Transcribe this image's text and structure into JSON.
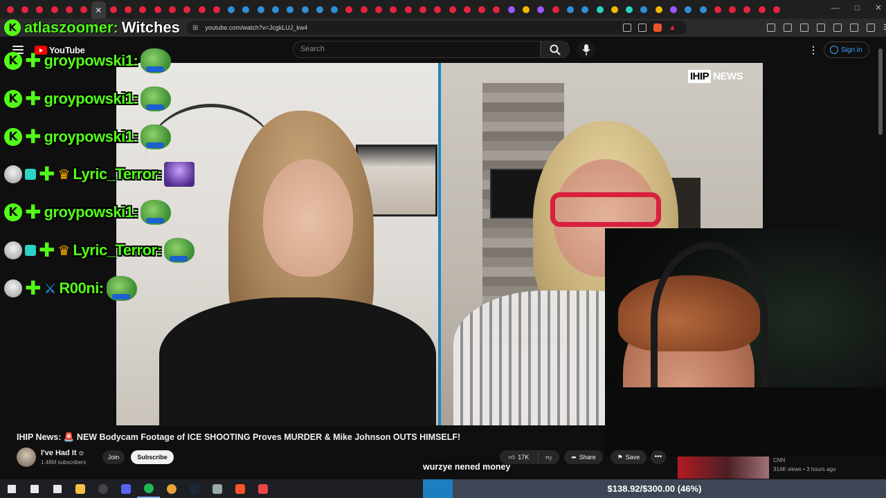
{
  "browser": {
    "url": "youtube.com/watch?v=JcgkLUJ_kw4",
    "tab_colors": [
      "#e8243d",
      "#e8243d",
      "#e8243d",
      "#e8243d",
      "#e8243d",
      "#e8243d",
      "#3a3a3a",
      "#e8243d",
      "#e8243d",
      "#e8243d",
      "#e8243d",
      "#e8243d",
      "#e8243d",
      "#e8243d",
      "#e8243d",
      "#2f8fd6",
      "#2f8fd6",
      "#2f8fd6",
      "#2f8fd6",
      "#2f8fd6",
      "#2f8fd6",
      "#2f8fd6",
      "#2f8fd6",
      "#e8243d",
      "#e8243d",
      "#e8243d",
      "#e8243d",
      "#e8243d",
      "#e8243d",
      "#e8243d",
      "#e8243d",
      "#e8243d",
      "#e8243d",
      "#e8243d",
      "#9b59ff",
      "#f5b700",
      "#9b59ff",
      "#e8243d",
      "#2f8fd6",
      "#2f8fd6",
      "#2ad4c4",
      "#f5b700",
      "#2ad4c4",
      "#2f8fd6",
      "#f5b700",
      "#9b59ff",
      "#2f8fd6",
      "#2f8fd6",
      "#e8243d",
      "#e8243d",
      "#e8243d",
      "#e8243d",
      "#e8243d"
    ]
  },
  "youtube": {
    "logo_text": "YouTube",
    "search_placeholder": "Search",
    "signin_label": "Sign in"
  },
  "video": {
    "watermark_box": "IHIP",
    "watermark_text": "NEWS",
    "caption": "wurzye nened money",
    "title_prefix": "IHIP News: ",
    "title_emoji": "🚨",
    "title_rest": " NEW Bodycam Footage of ICE SHOOTING Proves MURDER & Mike Johnson OUTS HIMSELF!"
  },
  "channel": {
    "name": "I've Had It",
    "verified_mark": "⊙",
    "subscribers": "1.48M subscribers",
    "join_label": "Join",
    "subscribe_label": "Subscribe"
  },
  "actions": {
    "like_count": "17K",
    "share_label": "Share",
    "save_label": "Save",
    "more_label": "•••"
  },
  "recommended": {
    "channel": "CNN",
    "meta": "314K views • 3 hours ago"
  },
  "chat_header": {
    "name": "atlaszoomer:",
    "message": "Witches"
  },
  "chat": [
    {
      "user": "groypowski1:",
      "badges": [
        "kick",
        "plus"
      ],
      "emote": "pepe"
    },
    {
      "user": "groypowski1:",
      "badges": [
        "kick",
        "plus"
      ],
      "emote": "pepe"
    },
    {
      "user": "groypowski1:",
      "badges": [
        "kick",
        "plus"
      ],
      "emote": "pepe"
    },
    {
      "user": "Lyric_Terror:",
      "badges": [
        "avatar",
        "gift",
        "plus",
        "crown"
      ],
      "emote": "purple"
    },
    {
      "user": "groypowski1:",
      "badges": [
        "kick",
        "plus"
      ],
      "emote": "pepe"
    },
    {
      "user": "Lyric_Terror:",
      "badges": [
        "avatar",
        "gift",
        "plus",
        "crown"
      ],
      "emote": "pepe"
    },
    {
      "user": "R00ni:",
      "badges": [
        "avatar",
        "plus",
        "sword"
      ],
      "emote": "pepe"
    }
  ],
  "donation": {
    "text": "$138.92/$300.00 (46%)",
    "progress": 0.46
  },
  "taskbar_icons": [
    "windows-start-icon",
    "search-icon",
    "task-view-icon",
    "file-explorer-icon",
    "obs-icon",
    "discord-icon",
    "spotify-icon",
    "chrome-icon",
    "steam-icon",
    "app-icon",
    "brave-icon",
    "app-icon-2"
  ]
}
